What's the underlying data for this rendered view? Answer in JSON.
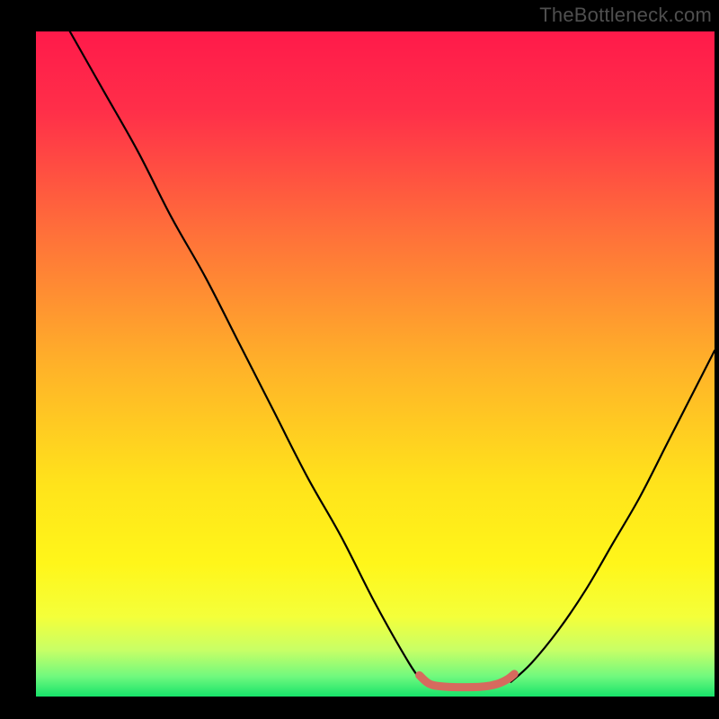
{
  "watermark": "TheBottleneck.com",
  "chart_data": {
    "type": "line",
    "title": "",
    "xlabel": "",
    "ylabel": "",
    "xlim": [
      0,
      100
    ],
    "ylim": [
      0,
      100
    ],
    "background_gradient_stops": [
      {
        "pos": 0.0,
        "color": "#ff1a4a"
      },
      {
        "pos": 0.12,
        "color": "#ff2f49"
      },
      {
        "pos": 0.3,
        "color": "#ff6f3a"
      },
      {
        "pos": 0.5,
        "color": "#ffb129"
      },
      {
        "pos": 0.68,
        "color": "#ffe31b"
      },
      {
        "pos": 0.8,
        "color": "#fff61a"
      },
      {
        "pos": 0.88,
        "color": "#f4ff3a"
      },
      {
        "pos": 0.93,
        "color": "#c8ff66"
      },
      {
        "pos": 0.97,
        "color": "#70f97e"
      },
      {
        "pos": 1.0,
        "color": "#17e36a"
      }
    ],
    "series": [
      {
        "name": "left-curve",
        "stroke": "#000000",
        "x": [
          5,
          10,
          15,
          20,
          25,
          30,
          35,
          40,
          45,
          50,
          55,
          57
        ],
        "y": [
          100,
          91,
          82,
          72,
          63,
          53,
          43,
          33,
          24,
          14,
          5,
          2.2
        ]
      },
      {
        "name": "right-curve",
        "stroke": "#000000",
        "x": [
          70,
          73,
          77,
          81,
          85,
          89,
          93,
          97,
          100
        ],
        "y": [
          2.2,
          5,
          10,
          16,
          23,
          30,
          38,
          46,
          52
        ]
      },
      {
        "name": "trough-marker",
        "stroke": "#d66a5e",
        "x": [
          56.5,
          58,
          60,
          63,
          66,
          68,
          69.5,
          70.5
        ],
        "y": [
          3.2,
          1.9,
          1.5,
          1.4,
          1.5,
          1.9,
          2.6,
          3.4
        ]
      }
    ]
  }
}
